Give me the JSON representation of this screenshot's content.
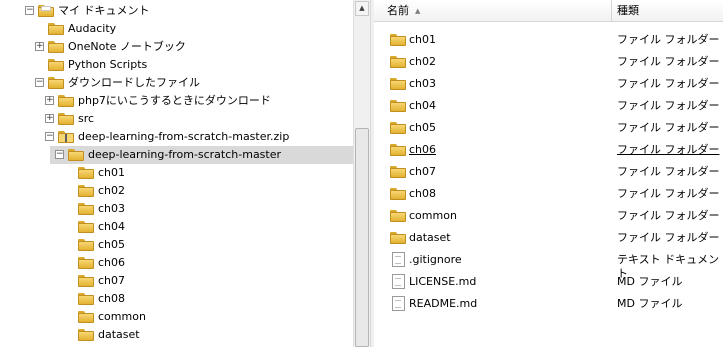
{
  "tree": {
    "items": [
      {
        "label": "マイ ドキュメント",
        "level": 0,
        "expander": "minus",
        "icon": "doc-folder"
      },
      {
        "label": "Audacity",
        "level": 1,
        "expander": "none",
        "icon": "folder"
      },
      {
        "label": "OneNote ノートブック",
        "level": 1,
        "expander": "plus",
        "icon": "folder"
      },
      {
        "label": "Python Scripts",
        "level": 1,
        "expander": "none",
        "icon": "folder"
      },
      {
        "label": "ダウンロードしたファイル",
        "level": 1,
        "expander": "minus",
        "icon": "folder"
      },
      {
        "label": "php7にいこうするときにダウンロード",
        "level": 2,
        "expander": "plus",
        "icon": "folder"
      },
      {
        "label": "src",
        "level": 2,
        "expander": "plus",
        "icon": "folder"
      },
      {
        "label": "deep-learning-from-scratch-master.zip",
        "level": 2,
        "expander": "minus",
        "icon": "zip-folder"
      },
      {
        "label": "deep-learning-from-scratch-master",
        "level": 3,
        "expander": "minus",
        "icon": "folder",
        "selected": true
      },
      {
        "label": "ch01",
        "level": 4,
        "expander": "none",
        "icon": "folder"
      },
      {
        "label": "ch02",
        "level": 4,
        "expander": "none",
        "icon": "folder"
      },
      {
        "label": "ch03",
        "level": 4,
        "expander": "none",
        "icon": "folder"
      },
      {
        "label": "ch04",
        "level": 4,
        "expander": "none",
        "icon": "folder"
      },
      {
        "label": "ch05",
        "level": 4,
        "expander": "none",
        "icon": "folder"
      },
      {
        "label": "ch06",
        "level": 4,
        "expander": "none",
        "icon": "folder"
      },
      {
        "label": "ch07",
        "level": 4,
        "expander": "none",
        "icon": "folder"
      },
      {
        "label": "ch08",
        "level": 4,
        "expander": "none",
        "icon": "folder"
      },
      {
        "label": "common",
        "level": 4,
        "expander": "none",
        "icon": "folder"
      },
      {
        "label": "dataset",
        "level": 4,
        "expander": "none",
        "icon": "folder"
      }
    ]
  },
  "list": {
    "columns": {
      "name": "名前",
      "type": "種類"
    },
    "rows": [
      {
        "name": "ch01",
        "type": "ファイル フォルダー",
        "icon": "folder"
      },
      {
        "name": "ch02",
        "type": "ファイル フォルダー",
        "icon": "folder"
      },
      {
        "name": "ch03",
        "type": "ファイル フォルダー",
        "icon": "folder"
      },
      {
        "name": "ch04",
        "type": "ファイル フォルダー",
        "icon": "folder"
      },
      {
        "name": "ch05",
        "type": "ファイル フォルダー",
        "icon": "folder"
      },
      {
        "name": "ch06",
        "type": "ファイル フォルダー",
        "icon": "folder",
        "hot": true
      },
      {
        "name": "ch07",
        "type": "ファイル フォルダー",
        "icon": "folder"
      },
      {
        "name": "ch08",
        "type": "ファイル フォルダー",
        "icon": "folder"
      },
      {
        "name": "common",
        "type": "ファイル フォルダー",
        "icon": "folder"
      },
      {
        "name": "dataset",
        "type": "ファイル フォルダー",
        "icon": "folder"
      },
      {
        "name": ".gitignore",
        "type": "テキスト ドキュメント",
        "icon": "text-file"
      },
      {
        "name": "LICENSE.md",
        "type": "MD ファイル",
        "icon": "file"
      },
      {
        "name": "README.md",
        "type": "MD ファイル",
        "icon": "file"
      }
    ]
  },
  "colors": {
    "selected_row": "#d9d9d9",
    "folder": "#e8bb3c"
  }
}
